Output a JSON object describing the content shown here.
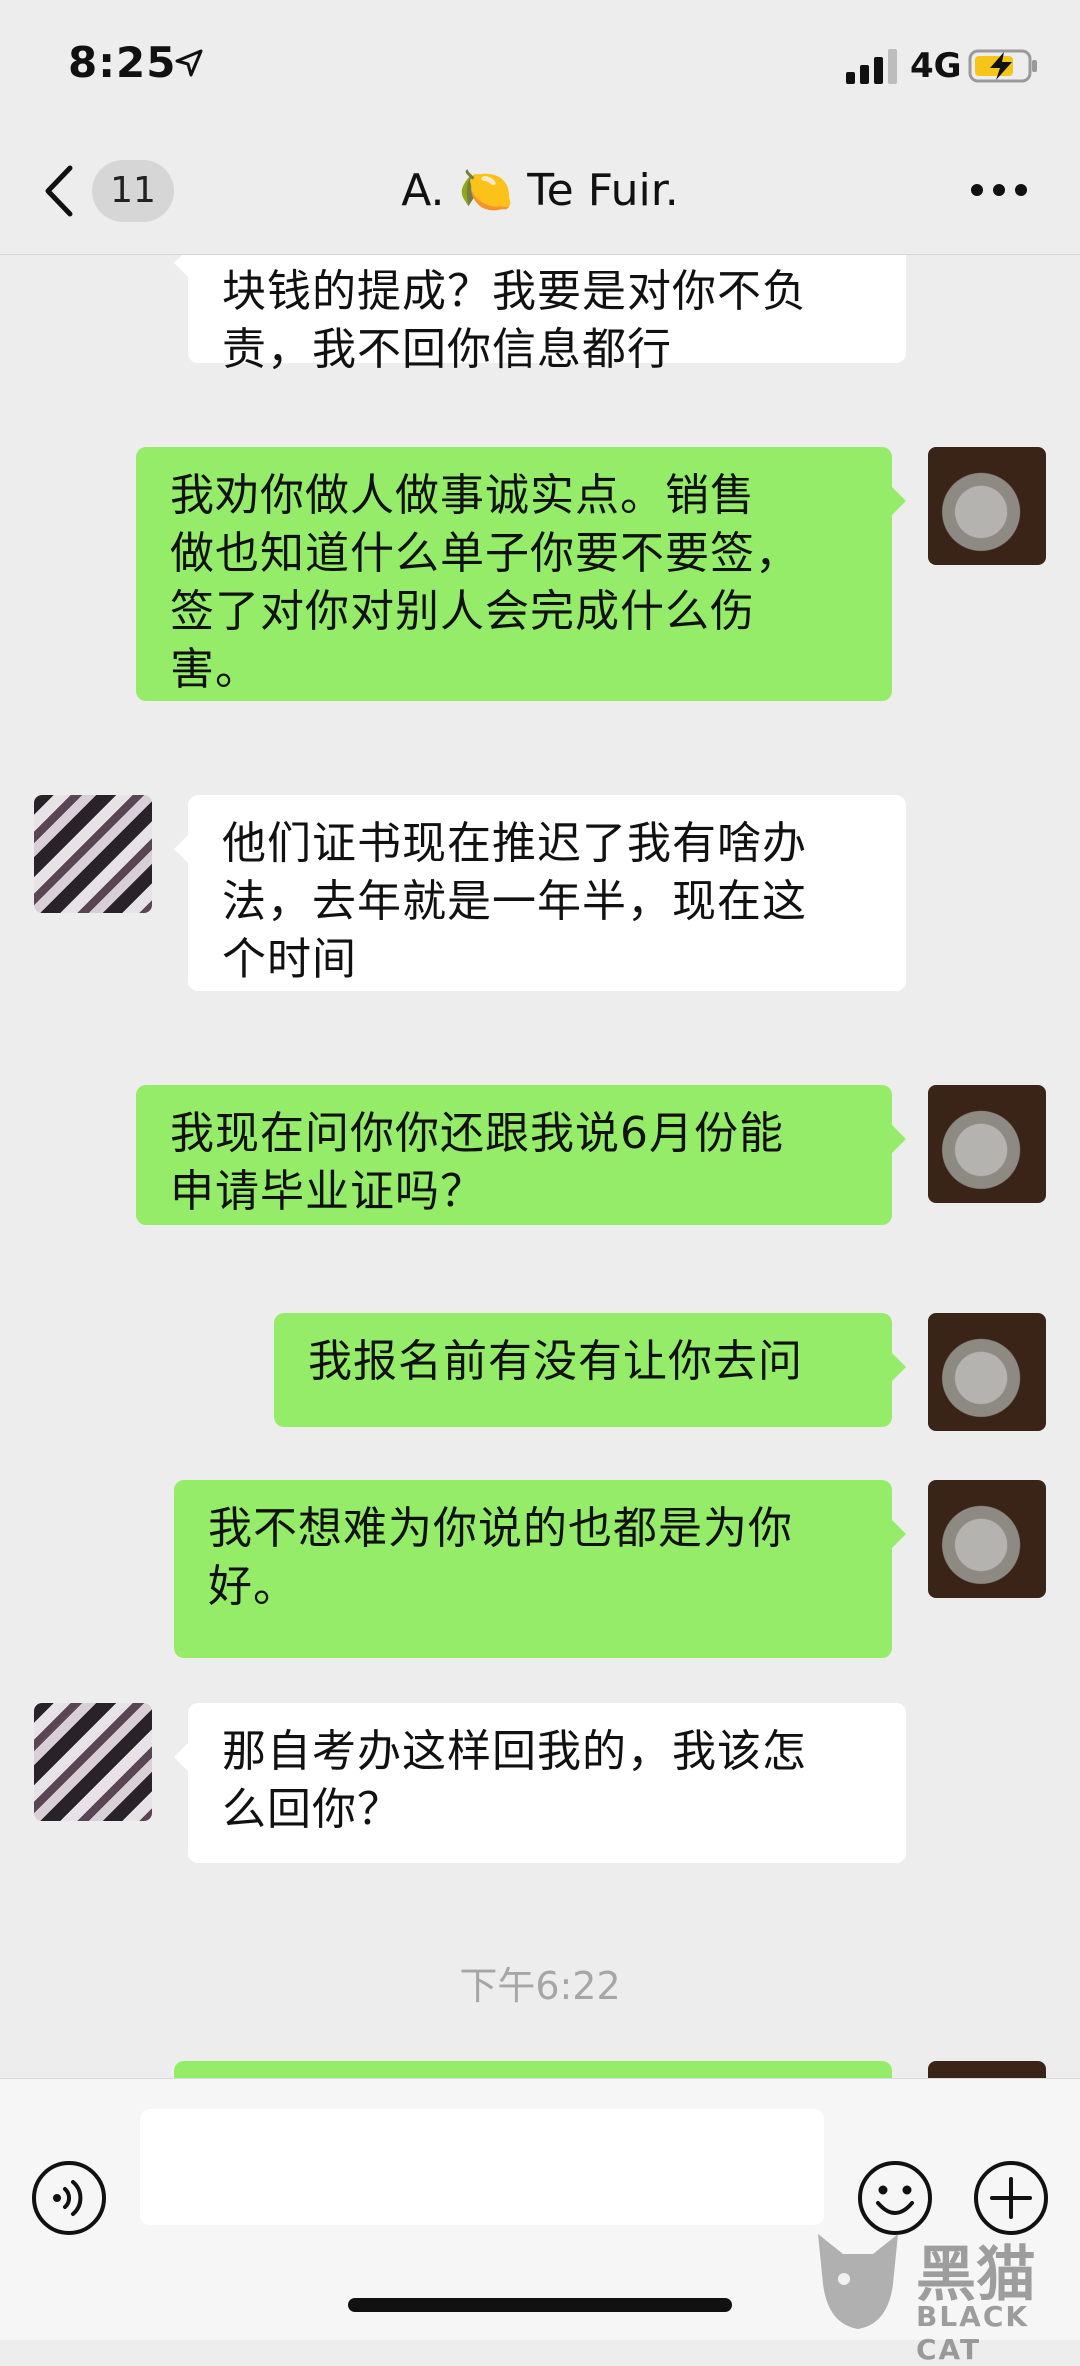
{
  "status_bar": {
    "time": "8:25",
    "network": "4G"
  },
  "nav": {
    "unread_count": "11",
    "chat_title": "A. 🍋 Te   Fuir."
  },
  "messages": [
    {
      "side": "in",
      "text": "块钱的提成？我要是对你不负\n责，我不回你信息都行"
    },
    {
      "side": "out",
      "text": "我劝你做人做事诚实点。销售\n做也知道什么单子你要不要签，\n签了对你对别人会完成什么伤\n害。"
    },
    {
      "side": "in",
      "text": "他们证书现在推迟了我有啥办\n法，去年就是一年半，现在这\n个时间"
    },
    {
      "side": "out",
      "text": "我现在问你你还跟我说6月份能\n申请毕业证吗？"
    },
    {
      "side": "out",
      "text": "我报名前有没有让你去问"
    },
    {
      "side": "out",
      "text": "我不想难为你说的也都是为你\n好。"
    },
    {
      "side": "in",
      "text": "那自考办这样回我的，我该怎\n么回你？"
    },
    {
      "side": "time",
      "text": "下午6:22"
    },
    {
      "side": "out",
      "text": ""
    }
  ],
  "watermark": {
    "text": "黑猫",
    "sub": "BLACK CAT"
  }
}
